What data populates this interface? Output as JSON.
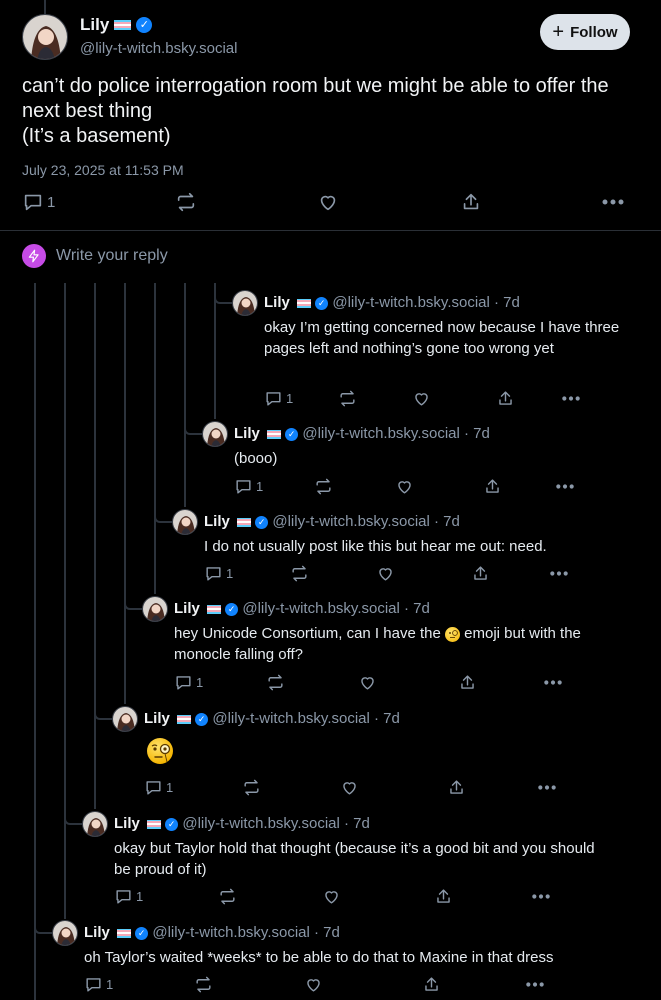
{
  "main_post": {
    "author_name": "Lily",
    "handle": "@lily-t-witch.bsky.social",
    "follow_label": "Follow",
    "text": "can’t do police interrogation room but we might be able to offer the next best thing\n(It’s a basement)",
    "timestamp": "July 23, 2025 at 11:53 PM",
    "reply_count": "1"
  },
  "reply_composer": {
    "placeholder": "Write your reply"
  },
  "replies": [
    {
      "name": "Lily",
      "handle": "@lily-t-witch.bsky.social",
      "time": "· 7d",
      "text": "okay I’m getting concerned now because I have three pages left and nothing’s gone too wrong yet",
      "reply_count": "1"
    },
    {
      "name": "Lily",
      "handle": "@lily-t-witch.bsky.social",
      "time": "· 7d",
      "text": "(booo)",
      "reply_count": "1"
    },
    {
      "name": "Lily",
      "handle": "@lily-t-witch.bsky.social",
      "time": "· 7d",
      "text": "I do not usually post like this but hear me out: need.",
      "reply_count": "1"
    },
    {
      "name": "Lily",
      "handle": "@lily-t-witch.bsky.social",
      "time": "· 7d",
      "text_before": "hey Unicode Consortium, can I have the ",
      "text_after": " emoji but with the monocle falling off?",
      "reply_count": "1"
    },
    {
      "name": "Lily",
      "handle": "@lily-t-witch.bsky.social",
      "time": "· 7d",
      "reply_count": "1"
    },
    {
      "name": "Lily",
      "handle": "@lily-t-witch.bsky.social",
      "time": "· 7d",
      "text": "okay but Taylor hold that thought (because it’s a good bit and you should be proud of it)",
      "reply_count": "1"
    },
    {
      "name": "Lily",
      "handle": "@lily-t-witch.bsky.social",
      "time": "· 7d",
      "text": "oh Taylor’s waited *weeks* to be able to do that to Maxine in that dress",
      "reply_count": "1"
    }
  ],
  "colors": {
    "background": "#000000",
    "accent": "#1083fe",
    "muted": "#8b98a8",
    "thread_line": "#2c333c",
    "reply_icon": "#c64be6"
  },
  "icons": [
    "reply-icon",
    "repost-icon",
    "like-icon",
    "share-icon",
    "more-icon",
    "verified-badge-icon",
    "trans-flag-icon",
    "monocle-face-emoji"
  ]
}
